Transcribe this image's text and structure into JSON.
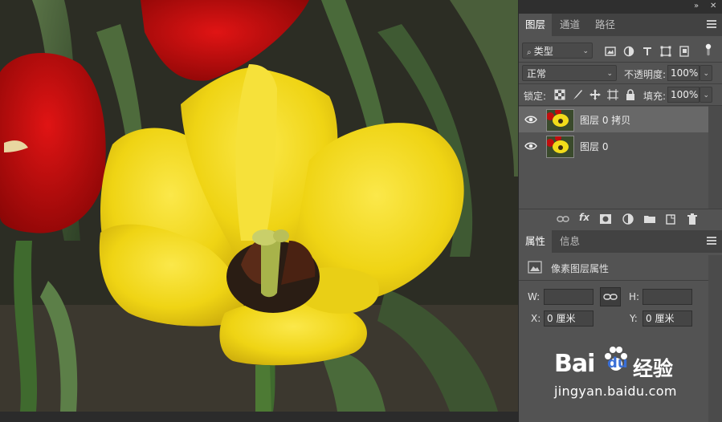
{
  "panel_header": {
    "collapse_label": "»",
    "close_label": "✕"
  },
  "layers_panel": {
    "tabs": [
      {
        "label": "图层",
        "active": true
      },
      {
        "label": "通道",
        "active": false
      },
      {
        "label": "路径",
        "active": false
      }
    ],
    "filter_kind": "类型",
    "blend_mode": "正常",
    "opacity_label": "不透明度:",
    "opacity_value": "100%",
    "lock_label": "锁定:",
    "fill_label": "填充:",
    "fill_value": "100%",
    "layers": [
      {
        "name": "图层 0 拷贝",
        "visible": true,
        "selected": true
      },
      {
        "name": "图层 0",
        "visible": true,
        "selected": false
      }
    ],
    "footer_icons": [
      "link-icon",
      "fx-icon",
      "mask-icon",
      "adjustment-icon",
      "folder-icon",
      "new-layer-icon",
      "trash-icon"
    ],
    "fx_label": "fx"
  },
  "properties_panel": {
    "tabs": [
      {
        "label": "属性",
        "active": true
      },
      {
        "label": "信息",
        "active": false
      }
    ],
    "title": "像素图层属性",
    "w_label": "W:",
    "h_label": "H:",
    "w_value": "",
    "h_value": "",
    "x_label": "X:",
    "x_value": "0 厘米",
    "y_label": "Y:",
    "y_value": "0 厘米"
  },
  "watermark": {
    "brand": "Bai",
    "brand_suffix": "du",
    "cn": "经验",
    "url": "jingyan.baidu.com"
  },
  "colors": {
    "panel_bg": "#535353",
    "tab_bar": "#424242",
    "selected_layer": "#666666",
    "flower_yellow": "#f2dc1a",
    "tulip_red": "#c10d0d"
  }
}
